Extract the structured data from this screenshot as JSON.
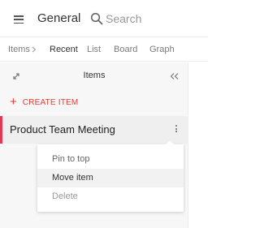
{
  "header": {
    "menu_icon": "hamburger-menu-icon",
    "title": "General",
    "search_icon": "search-icon",
    "search_placeholder": "Search"
  },
  "breadcrumb": {
    "root": "Items",
    "separator_icon": "chevron-right-icon",
    "views": [
      "Recent",
      "List",
      "Board",
      "Graph"
    ],
    "active_view": "Recent"
  },
  "panel": {
    "expand_icon": "expand-arrows-icon",
    "title": "Items",
    "collapse_icon": "double-chevron-left-icon",
    "create_icon": "plus-icon",
    "create_label": "CREATE ITEM"
  },
  "items": [
    {
      "title": "Product Team Meeting",
      "accent": "#e53950",
      "menu_icon": "kebab-menu-icon"
    }
  ],
  "context_menu": {
    "items": [
      "Pin to top",
      "Move item",
      "Delete"
    ],
    "hovered": "Move item"
  },
  "colors": {
    "accent": "#e53935",
    "panel_bg": "#f7f7f7",
    "selected_row_bg": "#efefef"
  }
}
